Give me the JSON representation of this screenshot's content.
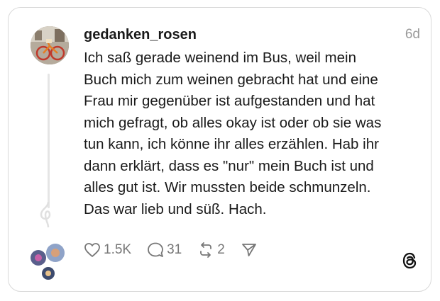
{
  "post": {
    "username": "gedanken_rosen",
    "time": "6d",
    "text": "Ich saß gerade weinend im Bus, weil mein\nBuch mich zum weinen gebracht hat und eine\nFrau mir gegenüber ist aufgestanden und hat\nmich gefragt, ob alles okay ist oder ob sie was\ntun kann, ich könne ihr alles erzählen. Hab ihr\ndann erklärt, dass es \"nur\" mein Buch ist und\nalles gut ist. Wir mussten beide schmunzeln.\nDas war lieb und süß. Hach."
  },
  "actions": {
    "likes": "1.5K",
    "replies": "31",
    "reposts": "2"
  },
  "icons": {
    "like": "heart-icon",
    "reply": "comment-icon",
    "repost": "repost-icon",
    "share": "send-icon",
    "brand": "threads-logo-icon"
  },
  "colors": {
    "text": "#1a1a1a",
    "muted": "#777777",
    "border": "#d9d9d9"
  }
}
